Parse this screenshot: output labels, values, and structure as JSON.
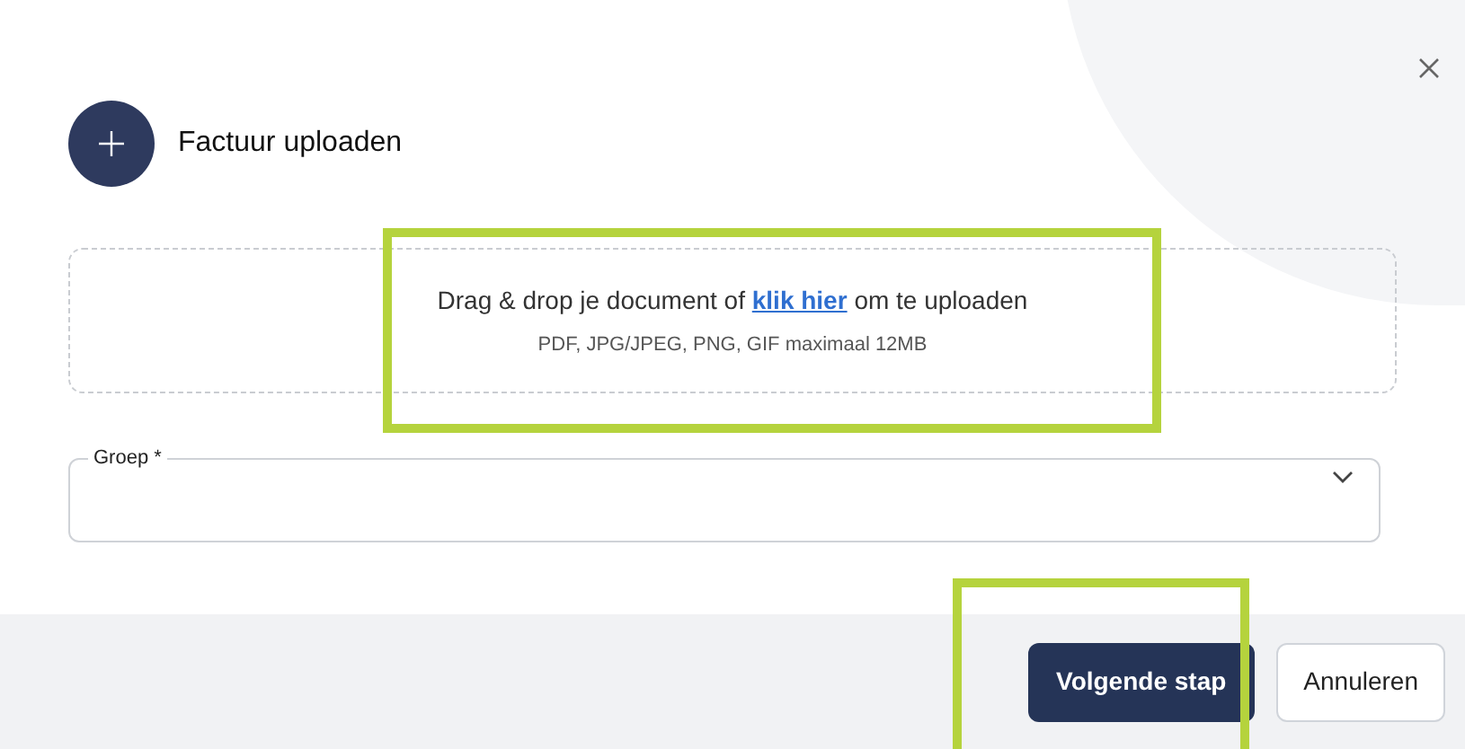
{
  "dialog": {
    "title": "Factuur uploaden"
  },
  "dropzone": {
    "text_before": "Drag & drop je document of",
    "link": "klik hier",
    "text_after": "om te uploaden",
    "hint": "PDF, JPG/JPEG, PNG, GIF maximaal 12MB"
  },
  "group_field": {
    "label": "Groep *"
  },
  "buttons": [
    {
      "label": "Volgende stap",
      "kind": "primary"
    },
    {
      "label": "Annuleren",
      "kind": "secondary"
    }
  ]
}
